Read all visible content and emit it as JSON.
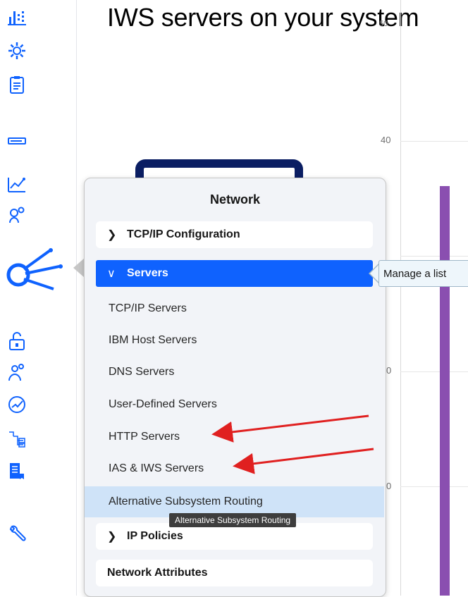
{
  "page": {
    "title": "IWS servers on your system"
  },
  "rail": {
    "icons": [
      "dashboard-icon",
      "settings-gear-icon",
      "clipboard-icon",
      "storage-icon",
      "performance-chart-icon",
      "config-gears-icon",
      "network-icon",
      "lock-icon",
      "users-icon",
      "gauge-icon",
      "workflow-icon",
      "journal-icon",
      "tools-icon"
    ]
  },
  "chart": {
    "ticks": [
      "50",
      "40",
      "0",
      "0",
      "0"
    ]
  },
  "popover": {
    "title": "Network",
    "groups": {
      "tcpip_config": "TCP/IP Configuration",
      "servers": "Servers",
      "ip_policies": "IP Policies",
      "network_attributes": "Network Attributes"
    },
    "server_items": [
      "TCP/IP Servers",
      "IBM Host Servers",
      "DNS Servers",
      "User-Defined Servers",
      "HTTP Servers",
      "IAS & IWS Servers",
      "Alternative Subsystem Routing"
    ],
    "hover_tooltip": "Alternative Subsystem Routing",
    "side_tooltip": "Manage a list"
  },
  "colors": {
    "accent": "#0f62fe",
    "hover": "#cfe3f8",
    "bar": "#8a4fb0",
    "annotation_arrow": "#e02020",
    "icon": "#0f62fe"
  }
}
